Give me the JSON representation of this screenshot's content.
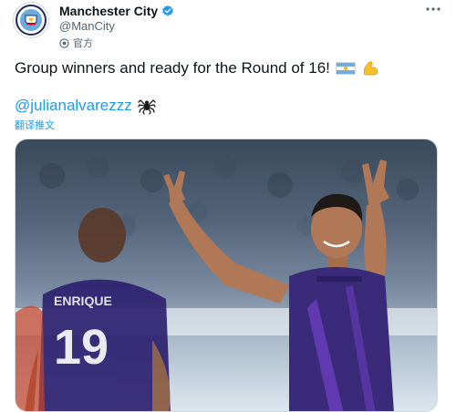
{
  "account": {
    "display_name": "Manchester City",
    "handle": "@ManCity",
    "official_label": "官方",
    "verified": true
  },
  "tweet": {
    "text": "Group winners and ready for the Round of 16!",
    "emojis": [
      "argentina-flag",
      "flexed-biceps"
    ],
    "mention": "@julianalvarezzz",
    "mention_emoji": "spider",
    "translate_label": "翻译推文"
  },
  "media": {
    "jersey_name": "ENRIQUE",
    "jersey_number": "19"
  },
  "colors": {
    "link": "#1d9bf0",
    "verified": "#1d9bf0",
    "secondary_text": "#536471",
    "jersey": "#3a2a7a",
    "city_blue": "#6cabdd"
  }
}
